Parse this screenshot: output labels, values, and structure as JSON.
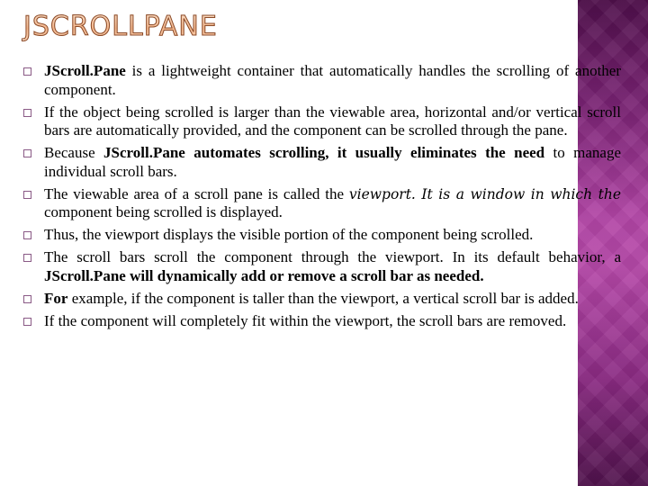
{
  "slide": {
    "title": "JSCROLLPANE",
    "accent_panel_color": "#b245a6",
    "bullet_icon": "square-outline-bullet",
    "items": [
      {
        "segments": [
          {
            "text": "JScroll.Pane",
            "style": "bold"
          },
          {
            "text": " is a lightweight container that automatically handles the scrolling of another component.",
            "style": "normal"
          }
        ]
      },
      {
        "segments": [
          {
            "text": "If the object being scrolled is larger than the viewable area, horizontal and/or vertical scroll bars are automatically provided, and the component can be scrolled through the pane.",
            "style": "normal"
          }
        ]
      },
      {
        "segments": [
          {
            "text": "Because ",
            "style": "normal"
          },
          {
            "text": "JScroll.Pane automates scrolling, it usually eliminates the need",
            "style": "bold"
          },
          {
            "text": " to manage individual scroll bars.",
            "style": "normal"
          }
        ]
      },
      {
        "segments": [
          {
            "text": "The viewable area of a scroll pane is called the ",
            "style": "normal"
          },
          {
            "text": "viewport. It is a window in which the",
            "style": "italic"
          },
          {
            "text": " component being scrolled is displayed.",
            "style": "normal"
          }
        ]
      },
      {
        "segments": [
          {
            "text": "Thus, the viewport displays the visible portion of the component being scrolled.",
            "style": "normal"
          }
        ]
      },
      {
        "segments": [
          {
            "text": "The scroll bars scroll the component through the viewport. In its default behavior, a ",
            "style": "normal"
          },
          {
            "text": "JScroll.Pane will dynamically add or remove a scroll bar as needed.",
            "style": "bold"
          }
        ]
      },
      {
        "segments": [
          {
            "text": " ",
            "style": "normal"
          },
          {
            "text": "For",
            "style": "bold"
          },
          {
            "text": " example, if the component is taller than the viewport, a vertical scroll bar is added.",
            "style": "normal"
          }
        ]
      },
      {
        "segments": [
          {
            "text": "If the component will completely fit within the viewport, the scroll bars are removed.",
            "style": "normal"
          }
        ]
      }
    ]
  }
}
